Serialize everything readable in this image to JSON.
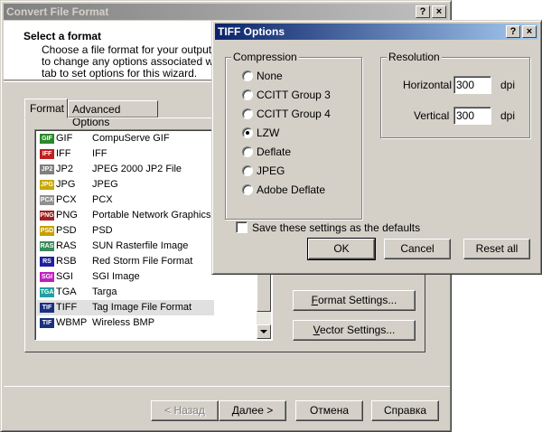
{
  "main_window": {
    "title": "Convert File Format",
    "help_btn": "?",
    "close_btn": "×",
    "heading": "Select a format",
    "desc_line1": "Choose a file format for your output file",
    "desc_line2": "to change any options associated with",
    "desc_line3": "tab to set options for this wizard.",
    "tabs": [
      "Format",
      "Advanced Options"
    ],
    "formats": [
      {
        "ext": "GIF",
        "desc": "CompuServe GIF",
        "icon_color": "#2a8a2a",
        "icon_text": "GIF"
      },
      {
        "ext": "IFF",
        "desc": "IFF",
        "icon_color": "#c02020",
        "icon_text": "IFF"
      },
      {
        "ext": "JP2",
        "desc": "JPEG 2000 JP2 File",
        "icon_color": "#808080",
        "icon_text": "JP2"
      },
      {
        "ext": "JPG",
        "desc": "JPEG",
        "icon_color": "#c8a800",
        "icon_text": "JPG"
      },
      {
        "ext": "PCX",
        "desc": "PCX",
        "icon_color": "#909090",
        "icon_text": "PCX"
      },
      {
        "ext": "PNG",
        "desc": "Portable Network Graphics",
        "icon_color": "#a02020",
        "icon_text": "PNG"
      },
      {
        "ext": "PSD",
        "desc": "PSD",
        "icon_color": "#c8a000",
        "icon_text": "PSD"
      },
      {
        "ext": "RAS",
        "desc": "SUN Rasterfile Image",
        "icon_color": "#3a8a5a",
        "icon_text": "RAS"
      },
      {
        "ext": "RSB",
        "desc": "Red Storm File Format",
        "icon_color": "#2020a0",
        "icon_text": "RS"
      },
      {
        "ext": "SGI",
        "desc": "SGI Image",
        "icon_color": "#c020c0",
        "icon_text": "SGI"
      },
      {
        "ext": "TGA",
        "desc": "Targa",
        "icon_color": "#20a0a0",
        "icon_text": "TGA"
      },
      {
        "ext": "TIFF",
        "desc": "Tag Image File Format",
        "icon_color": "#1a3080",
        "icon_text": "TIF"
      },
      {
        "ext": "WBMP",
        "desc": "Wireless BMP",
        "icon_color": "#1a3080",
        "icon_text": "TIF"
      }
    ],
    "format_settings": {
      "pre": "",
      "ul": "F",
      "post": "ormat Settings..."
    },
    "vector_settings": {
      "pre": "",
      "ul": "V",
      "post": "ector Settings..."
    },
    "back_btn": "< Назад",
    "next_btn": "Далее >",
    "cancel_btn": "Отмена",
    "help_btn_footer": "Справка"
  },
  "tiff_dialog": {
    "title": "TIFF Options",
    "help_btn": "?",
    "close_btn": "×",
    "compression_label": "Compression",
    "compression_options": [
      "None",
      "CCITT Group 3",
      "CCITT Group 4",
      "LZW",
      "Deflate",
      "JPEG",
      "Adobe Deflate"
    ],
    "selected_index": 3,
    "resolution_label": "Resolution",
    "horizontal_label": "Horizontal",
    "horizontal_value": "300",
    "vertical_label": "Vertical",
    "vertical_value": "300",
    "dpi_unit": "dpi",
    "save_defaults_label": "Save these settings as the defaults",
    "ok_btn": "OK",
    "cancel_btn": "Cancel",
    "reset_btn": "Reset all"
  }
}
